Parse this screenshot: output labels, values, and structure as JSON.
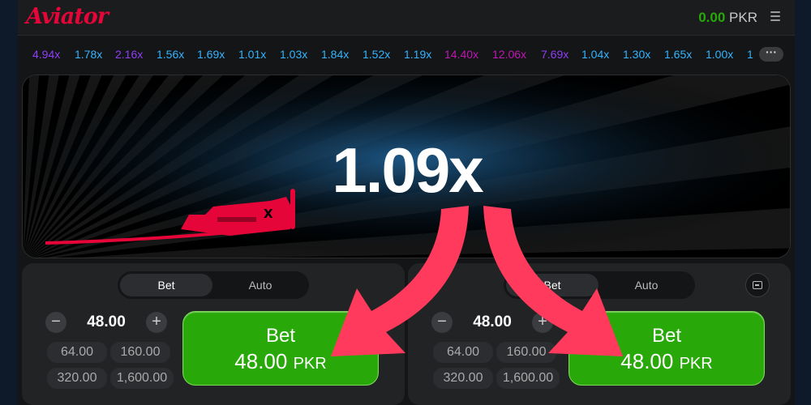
{
  "header": {
    "logo": "Aviator",
    "balance_amount": "0.00",
    "balance_currency": "PKR",
    "menu_icon": "hamburger-icon"
  },
  "history": {
    "items": [
      {
        "value": "4.94x",
        "color": "#913ef8"
      },
      {
        "value": "1.78x",
        "color": "#34b4ff"
      },
      {
        "value": "2.16x",
        "color": "#913ef8"
      },
      {
        "value": "1.56x",
        "color": "#34b4ff"
      },
      {
        "value": "1.69x",
        "color": "#34b4ff"
      },
      {
        "value": "1.01x",
        "color": "#34b4ff"
      },
      {
        "value": "1.03x",
        "color": "#34b4ff"
      },
      {
        "value": "1.84x",
        "color": "#34b4ff"
      },
      {
        "value": "1.52x",
        "color": "#34b4ff"
      },
      {
        "value": "1.19x",
        "color": "#34b4ff"
      },
      {
        "value": "14.40x",
        "color": "#c017b4"
      },
      {
        "value": "12.06x",
        "color": "#c017b4"
      },
      {
        "value": "7.69x",
        "color": "#913ef8"
      },
      {
        "value": "1.04x",
        "color": "#34b4ff"
      },
      {
        "value": "1.30x",
        "color": "#34b4ff"
      },
      {
        "value": "1.65x",
        "color": "#34b4ff"
      },
      {
        "value": "1.00x",
        "color": "#34b4ff"
      },
      {
        "value": "1",
        "color": "#34b4ff"
      }
    ],
    "more_label": "···"
  },
  "game": {
    "multiplier": "1.09x",
    "plane_icon": "airplane-icon"
  },
  "panels": [
    {
      "tabs": [
        "Bet",
        "Auto"
      ],
      "amount": "48.00",
      "minus": "−",
      "plus": "+",
      "quick": [
        "64.00",
        "160.00",
        "320.00",
        "1,600.00"
      ],
      "bet_label": "Bet",
      "bet_amount": "48.00",
      "bet_currency": "PKR"
    },
    {
      "tabs": [
        "Bet",
        "Auto"
      ],
      "amount": "48.00",
      "minus": "−",
      "plus": "+",
      "quick": [
        "64.00",
        "160.00",
        "320.00",
        "1,600.00"
      ],
      "bet_label": "Bet",
      "bet_amount": "48.00",
      "bet_currency": "PKR"
    }
  ],
  "colors": {
    "accent_red": "#e50539",
    "bet_green": "#28a909",
    "arrow": "#ff3a5c"
  }
}
